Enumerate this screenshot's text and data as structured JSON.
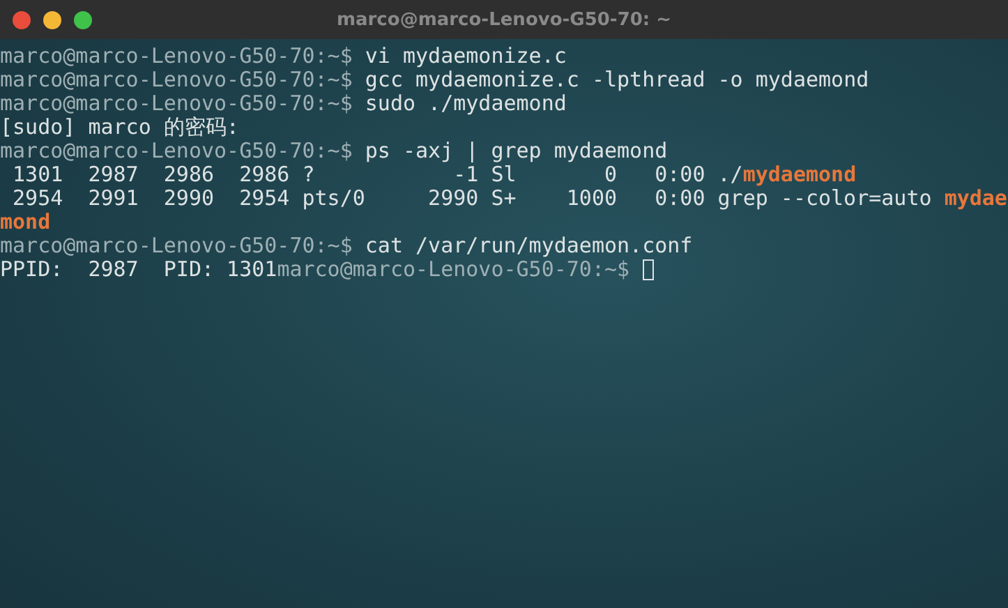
{
  "window": {
    "title": "marco@marco-Lenovo-G50-70: ~"
  },
  "lines": [
    {
      "segments": [
        {
          "kind": "prompt",
          "text": "marco@marco-Lenovo-G50-70:~$"
        },
        {
          "kind": "command",
          "text": " vi mydaemonize.c"
        }
      ]
    },
    {
      "segments": [
        {
          "kind": "prompt",
          "text": "marco@marco-Lenovo-G50-70:~$"
        },
        {
          "kind": "command",
          "text": " gcc mydaemonize.c -lpthread -o mydaemond"
        }
      ]
    },
    {
      "segments": [
        {
          "kind": "prompt",
          "text": "marco@marco-Lenovo-G50-70:~$"
        },
        {
          "kind": "command",
          "text": " sudo ./mydaemond"
        }
      ]
    },
    {
      "segments": [
        {
          "kind": "output",
          "text": "[sudo] marco 的密码:"
        }
      ]
    },
    {
      "segments": [
        {
          "kind": "prompt",
          "text": "marco@marco-Lenovo-G50-70:~$"
        },
        {
          "kind": "command",
          "text": " ps -axj | grep mydaemond"
        }
      ]
    },
    {
      "segments": [
        {
          "kind": "output",
          "text": " 1301  2987  2986  2986 ?           -1 Sl       0   0:00 ./"
        },
        {
          "kind": "match",
          "text": "mydaemond"
        }
      ]
    },
    {
      "segments": [
        {
          "kind": "output",
          "text": " 2954  2991  2990  2954 pts/0     2990 S+    1000   0:00 grep --color=auto "
        },
        {
          "kind": "match",
          "text": "mydae"
        }
      ]
    },
    {
      "segments": [
        {
          "kind": "match",
          "text": "mond"
        }
      ]
    },
    {
      "segments": [
        {
          "kind": "prompt",
          "text": "marco@marco-Lenovo-G50-70:~$"
        },
        {
          "kind": "command",
          "text": " cat /var/run/mydaemon.conf"
        }
      ]
    },
    {
      "segments": [
        {
          "kind": "output",
          "text": "PPID:  2987  PID: 1301"
        },
        {
          "kind": "prompt",
          "text": "marco@marco-Lenovo-G50-70:~$"
        },
        {
          "kind": "cursor"
        }
      ]
    }
  ]
}
